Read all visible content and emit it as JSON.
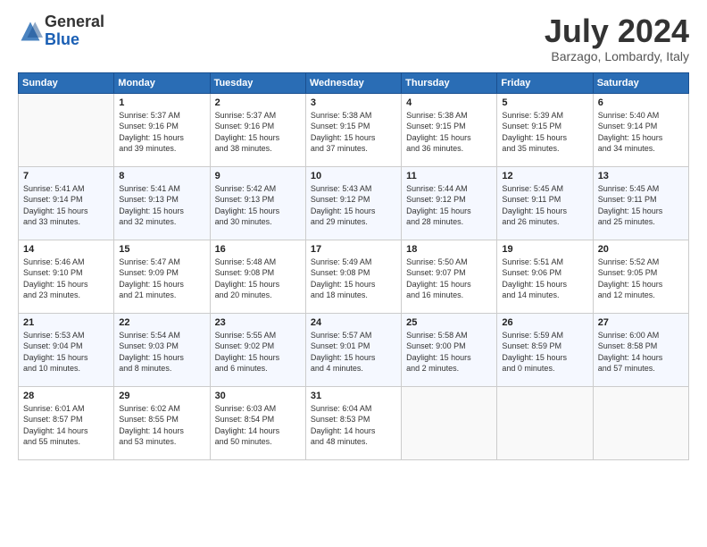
{
  "header": {
    "logo_general": "General",
    "logo_blue": "Blue",
    "month_title": "July 2024",
    "location": "Barzago, Lombardy, Italy"
  },
  "days_of_week": [
    "Sunday",
    "Monday",
    "Tuesday",
    "Wednesday",
    "Thursday",
    "Friday",
    "Saturday"
  ],
  "weeks": [
    [
      {
        "day": "",
        "content": ""
      },
      {
        "day": "1",
        "content": "Sunrise: 5:37 AM\nSunset: 9:16 PM\nDaylight: 15 hours\nand 39 minutes."
      },
      {
        "day": "2",
        "content": "Sunrise: 5:37 AM\nSunset: 9:16 PM\nDaylight: 15 hours\nand 38 minutes."
      },
      {
        "day": "3",
        "content": "Sunrise: 5:38 AM\nSunset: 9:15 PM\nDaylight: 15 hours\nand 37 minutes."
      },
      {
        "day": "4",
        "content": "Sunrise: 5:38 AM\nSunset: 9:15 PM\nDaylight: 15 hours\nand 36 minutes."
      },
      {
        "day": "5",
        "content": "Sunrise: 5:39 AM\nSunset: 9:15 PM\nDaylight: 15 hours\nand 35 minutes."
      },
      {
        "day": "6",
        "content": "Sunrise: 5:40 AM\nSunset: 9:14 PM\nDaylight: 15 hours\nand 34 minutes."
      }
    ],
    [
      {
        "day": "7",
        "content": "Sunrise: 5:41 AM\nSunset: 9:14 PM\nDaylight: 15 hours\nand 33 minutes."
      },
      {
        "day": "8",
        "content": "Sunrise: 5:41 AM\nSunset: 9:13 PM\nDaylight: 15 hours\nand 32 minutes."
      },
      {
        "day": "9",
        "content": "Sunrise: 5:42 AM\nSunset: 9:13 PM\nDaylight: 15 hours\nand 30 minutes."
      },
      {
        "day": "10",
        "content": "Sunrise: 5:43 AM\nSunset: 9:12 PM\nDaylight: 15 hours\nand 29 minutes."
      },
      {
        "day": "11",
        "content": "Sunrise: 5:44 AM\nSunset: 9:12 PM\nDaylight: 15 hours\nand 28 minutes."
      },
      {
        "day": "12",
        "content": "Sunrise: 5:45 AM\nSunset: 9:11 PM\nDaylight: 15 hours\nand 26 minutes."
      },
      {
        "day": "13",
        "content": "Sunrise: 5:45 AM\nSunset: 9:11 PM\nDaylight: 15 hours\nand 25 minutes."
      }
    ],
    [
      {
        "day": "14",
        "content": "Sunrise: 5:46 AM\nSunset: 9:10 PM\nDaylight: 15 hours\nand 23 minutes."
      },
      {
        "day": "15",
        "content": "Sunrise: 5:47 AM\nSunset: 9:09 PM\nDaylight: 15 hours\nand 21 minutes."
      },
      {
        "day": "16",
        "content": "Sunrise: 5:48 AM\nSunset: 9:08 PM\nDaylight: 15 hours\nand 20 minutes."
      },
      {
        "day": "17",
        "content": "Sunrise: 5:49 AM\nSunset: 9:08 PM\nDaylight: 15 hours\nand 18 minutes."
      },
      {
        "day": "18",
        "content": "Sunrise: 5:50 AM\nSunset: 9:07 PM\nDaylight: 15 hours\nand 16 minutes."
      },
      {
        "day": "19",
        "content": "Sunrise: 5:51 AM\nSunset: 9:06 PM\nDaylight: 15 hours\nand 14 minutes."
      },
      {
        "day": "20",
        "content": "Sunrise: 5:52 AM\nSunset: 9:05 PM\nDaylight: 15 hours\nand 12 minutes."
      }
    ],
    [
      {
        "day": "21",
        "content": "Sunrise: 5:53 AM\nSunset: 9:04 PM\nDaylight: 15 hours\nand 10 minutes."
      },
      {
        "day": "22",
        "content": "Sunrise: 5:54 AM\nSunset: 9:03 PM\nDaylight: 15 hours\nand 8 minutes."
      },
      {
        "day": "23",
        "content": "Sunrise: 5:55 AM\nSunset: 9:02 PM\nDaylight: 15 hours\nand 6 minutes."
      },
      {
        "day": "24",
        "content": "Sunrise: 5:57 AM\nSunset: 9:01 PM\nDaylight: 15 hours\nand 4 minutes."
      },
      {
        "day": "25",
        "content": "Sunrise: 5:58 AM\nSunset: 9:00 PM\nDaylight: 15 hours\nand 2 minutes."
      },
      {
        "day": "26",
        "content": "Sunrise: 5:59 AM\nSunset: 8:59 PM\nDaylight: 15 hours\nand 0 minutes."
      },
      {
        "day": "27",
        "content": "Sunrise: 6:00 AM\nSunset: 8:58 PM\nDaylight: 14 hours\nand 57 minutes."
      }
    ],
    [
      {
        "day": "28",
        "content": "Sunrise: 6:01 AM\nSunset: 8:57 PM\nDaylight: 14 hours\nand 55 minutes."
      },
      {
        "day": "29",
        "content": "Sunrise: 6:02 AM\nSunset: 8:55 PM\nDaylight: 14 hours\nand 53 minutes."
      },
      {
        "day": "30",
        "content": "Sunrise: 6:03 AM\nSunset: 8:54 PM\nDaylight: 14 hours\nand 50 minutes."
      },
      {
        "day": "31",
        "content": "Sunrise: 6:04 AM\nSunset: 8:53 PM\nDaylight: 14 hours\nand 48 minutes."
      },
      {
        "day": "",
        "content": ""
      },
      {
        "day": "",
        "content": ""
      },
      {
        "day": "",
        "content": ""
      }
    ]
  ]
}
